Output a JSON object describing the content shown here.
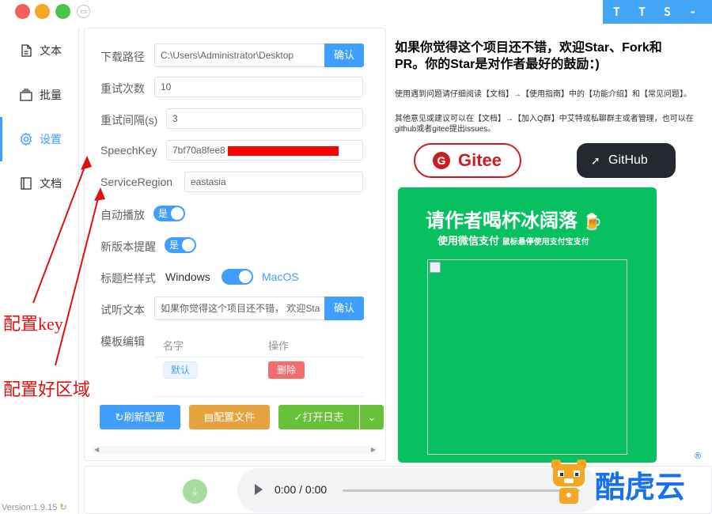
{
  "app": {
    "brand": "T T S - V U E",
    "version": "Version:1.9.15"
  },
  "sidebar": {
    "items": [
      {
        "label": "文本",
        "icon": "document-icon"
      },
      {
        "label": "批量",
        "icon": "batch-icon"
      },
      {
        "label": "设置",
        "icon": "gear-icon",
        "active": true
      },
      {
        "label": "文档",
        "icon": "book-icon"
      }
    ]
  },
  "settings": {
    "download_path_label": "下载路径",
    "download_path_value": "C:\\Users\\Administrator\\Desktop",
    "confirm_label": "确认",
    "retry_count_label": "重试次数",
    "retry_count_value": "10",
    "retry_interval_label": "重试间隔(s)",
    "retry_interval_value": "3",
    "speech_key_label": "SpeechKey",
    "speech_key_value": "7bf70a8fee8",
    "service_region_label": "ServiceRegion",
    "service_region_value": "eastasia",
    "autoplay_label": "自动播放",
    "autoplay_switch": "是",
    "update_notice_label": "新版本提醒",
    "update_notice_switch": "是",
    "titlebar_style_label": "标题栏样式",
    "titlebar_style_left": "Windows",
    "titlebar_style_right": "MacOS",
    "preview_text_label": "试听文本",
    "preview_text_value": "如果你觉得这个项目还不错， 欢迎Sta",
    "template_label": "模板编辑",
    "template_table": {
      "headers": [
        "名字",
        "操作"
      ],
      "rows": [
        {
          "name": "默认",
          "action": "删除"
        }
      ]
    },
    "buttons": {
      "refresh": "刷新配置",
      "config_file": "配置文件",
      "open_log": "打开日志"
    }
  },
  "info": {
    "title": "如果你觉得这个项目还不错，欢迎Star、Fork和PR。你的Star是对作者最好的鼓励：)",
    "line1": "使用遇到问题请仔细阅读【文档】→【使用指南】中的【功能介绍】和【常见问题】。",
    "line2": "其他意见或建议可以在【文档】→【加入Q群】中艾特或私聊群主或者管理，也可以在github或者gitee提出issues。",
    "gitee_label": "Gitee",
    "github_label": "GitHub",
    "pay_title": "请作者喝杯冰阔落",
    "pay_sub": "使用微信支付",
    "pay_sub_small": "鼠标悬停使用支付宝支付"
  },
  "player": {
    "time": "0:00 / 0:00"
  },
  "annotations": {
    "key": "配置key",
    "region": "配置好区域"
  },
  "watermark": {
    "text": "酷虎云",
    "reg": "®"
  },
  "colors": {
    "primary": "#409eff",
    "warning": "#e6a23c",
    "success": "#67c23a",
    "danger": "#f56c6c",
    "wechat": "#07c160",
    "annotation": "#e01010"
  }
}
